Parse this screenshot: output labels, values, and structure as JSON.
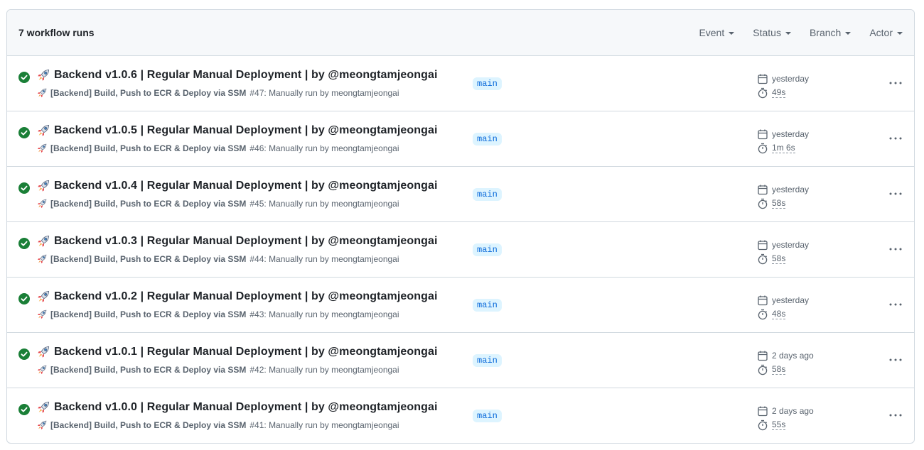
{
  "header": {
    "runs_count": "7 workflow runs",
    "filters": [
      "Event",
      "Status",
      "Branch",
      "Actor"
    ]
  },
  "icons": {
    "status": "check-circle-fill-icon",
    "rocket": "rocket-emoji-icon",
    "calendar": "calendar-icon",
    "stopwatch": "stopwatch-icon",
    "kebab": "kebab-horizontal-icon"
  },
  "colors": {
    "success": "#1a7f37",
    "branch_bg": "#ddf4ff",
    "branch_fg": "#0969da"
  },
  "runs": [
    {
      "title": "Backend v1.0.6 | Regular Manual Deployment | by @meongtamjeongai",
      "workflow": "[Backend] Build, Push to ECR & Deploy via SSM",
      "run_info": "#47: Manually run by meongtamjeongai",
      "branch": "main",
      "when": "yesterday",
      "duration": "49s"
    },
    {
      "title": "Backend v1.0.5 | Regular Manual Deployment | by @meongtamjeongai",
      "workflow": "[Backend] Build, Push to ECR & Deploy via SSM",
      "run_info": "#46: Manually run by meongtamjeongai",
      "branch": "main",
      "when": "yesterday",
      "duration": "1m 6s"
    },
    {
      "title": "Backend v1.0.4 | Regular Manual Deployment | by @meongtamjeongai",
      "workflow": "[Backend] Build, Push to ECR & Deploy via SSM",
      "run_info": "#45: Manually run by meongtamjeongai",
      "branch": "main",
      "when": "yesterday",
      "duration": "58s"
    },
    {
      "title": "Backend v1.0.3 | Regular Manual Deployment | by @meongtamjeongai",
      "workflow": "[Backend] Build, Push to ECR & Deploy via SSM",
      "run_info": "#44: Manually run by meongtamjeongai",
      "branch": "main",
      "when": "yesterday",
      "duration": "58s"
    },
    {
      "title": "Backend v1.0.2 | Regular Manual Deployment | by @meongtamjeongai",
      "workflow": "[Backend] Build, Push to ECR & Deploy via SSM",
      "run_info": "#43: Manually run by meongtamjeongai",
      "branch": "main",
      "when": "yesterday",
      "duration": "48s"
    },
    {
      "title": "Backend v1.0.1 | Regular Manual Deployment | by @meongtamjeongai",
      "workflow": "[Backend] Build, Push to ECR & Deploy via SSM",
      "run_info": "#42: Manually run by meongtamjeongai",
      "branch": "main",
      "when": "2 days ago",
      "duration": "58s"
    },
    {
      "title": "Backend v1.0.0 | Regular Manual Deployment | by @meongtamjeongai",
      "workflow": "[Backend] Build, Push to ECR & Deploy via SSM",
      "run_info": "#41: Manually run by meongtamjeongai",
      "branch": "main",
      "when": "2 days ago",
      "duration": "55s"
    }
  ]
}
